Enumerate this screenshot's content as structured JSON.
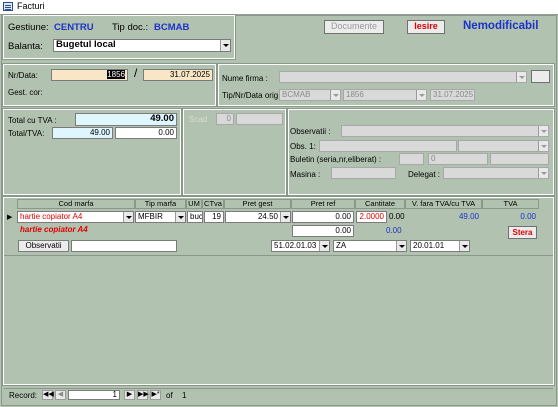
{
  "window": {
    "title": "Facturi"
  },
  "header": {
    "gestiune_label": "Gestiune:",
    "gestiune_value": "CENTRU",
    "tipdoc_label": "Tip doc.:",
    "tipdoc_value": "BCMAB",
    "balanta_label": "Balanta:",
    "balanta_value": "Bugetul local",
    "documente_button": "Documente",
    "iesire_button": "Iesire",
    "status_text": "Nemodificabil"
  },
  "doc": {
    "nrdata_label": "Nr/Data:",
    "nr_value": "1856",
    "data_value": "31.07.2025",
    "gest_cor_label": "Gest. cor:",
    "nume_firma_label": "Nume firma :",
    "nume_firma_value": "",
    "tipnrdata_label": "Tip/Nr/Data orig",
    "orig_tip": "BCMAB",
    "orig_nr": "1856",
    "orig_data": "31.07.2025"
  },
  "totals": {
    "total_tva_label": "Total cu TVA :",
    "total_tva_value": "49.00",
    "total_tva_split_label": "Total/TVA:",
    "total_value": "49.00",
    "tva_value": "0.00",
    "scad_label": "Scad",
    "scad_value": "0"
  },
  "extra": {
    "observatii_label": "Observatii :",
    "obs1_label": "Obs. 1:",
    "buletin_label": "Buletin (seria,nr,eliberat) :",
    "buletin_nr": "0",
    "masina_label": "Masina :",
    "delegat_label": "Delegat :"
  },
  "grid": {
    "columns": [
      "Cod marfa",
      "Tip marfa",
      "UM",
      "CTva",
      "Pret gest",
      "Pret ref",
      "Cantitate",
      "V. fara TVA/cu TVA",
      "TVA"
    ],
    "row": {
      "cod_marfa": "hartie copiator A4",
      "tip_marfa": "MFBIR",
      "um": "buc",
      "ctva": "19",
      "pret_gest": "24.50",
      "pret_ref": "0.00",
      "pret_ref2": "0.00",
      "cantitate": "2.0000",
      "v_fara_tva": "0.00",
      "v_cu_tva": "49.00",
      "tva": "0.00",
      "tva2": "0.00",
      "description": "hartie copiator A4",
      "sterge_button": "Stera",
      "observatii_label": "Observatii",
      "observatii_value": "",
      "cont1": "51.02.01.03",
      "cont2": "ZA",
      "cont3": "20.01.01"
    }
  },
  "nav": {
    "record_label": "Record:",
    "current": "1",
    "of_label": "of",
    "total": "1"
  }
}
